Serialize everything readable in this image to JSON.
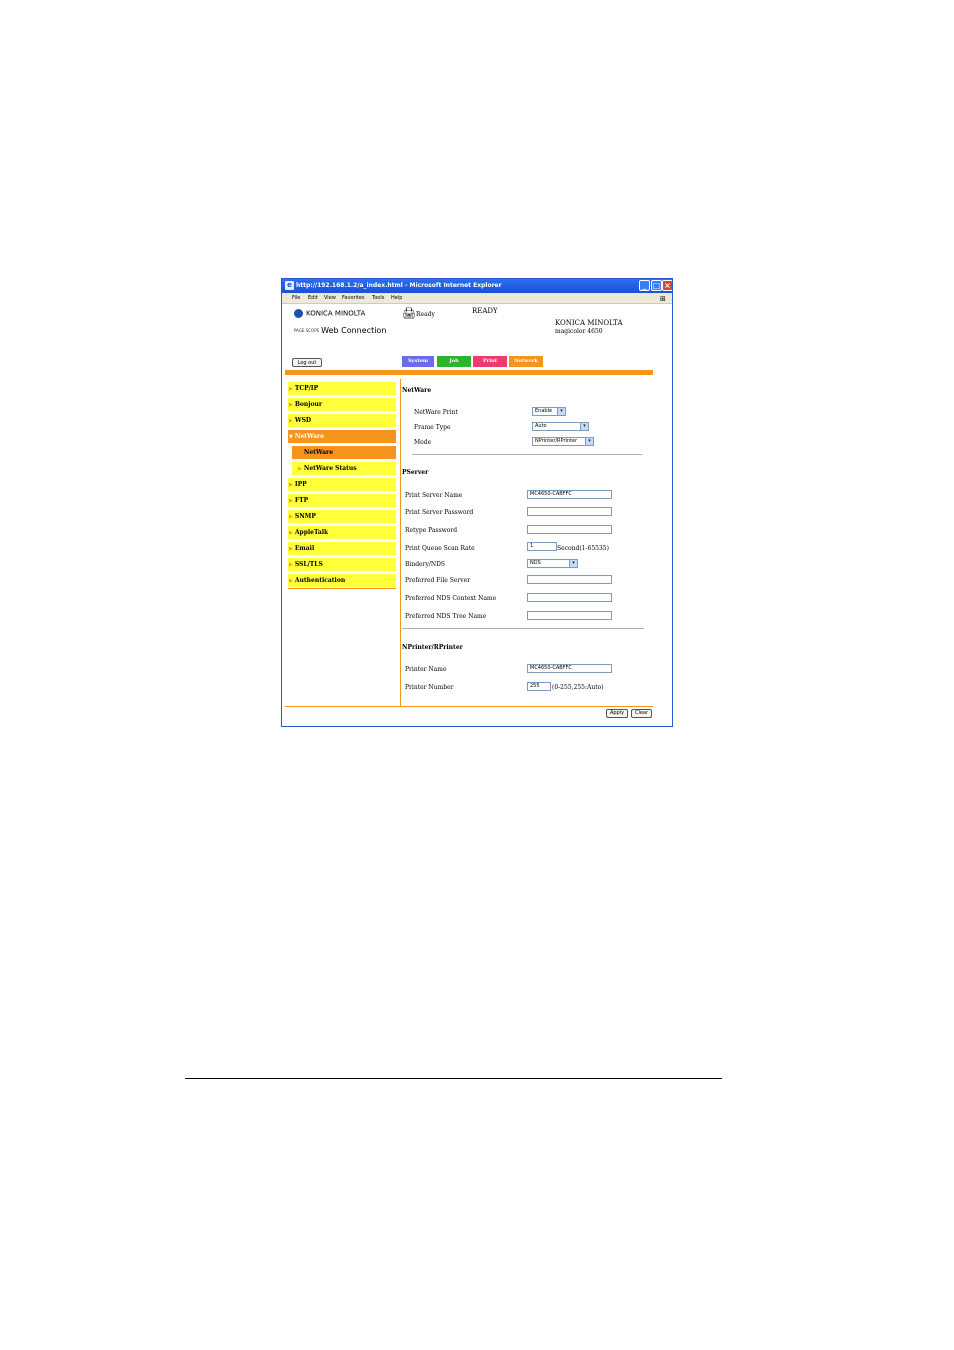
{
  "window": {
    "title": "http://192.168.1.2/a_index.html - Microsoft Internet Explorer",
    "menu": [
      "File",
      "Edit",
      "View",
      "Favorites",
      "Tools",
      "Help"
    ]
  },
  "header": {
    "brand": "KONICA MINOLTA",
    "pagescope_small": "PAGE SCOPE",
    "product": "Web Connection",
    "status_short": "Ready",
    "status_caps": "READY",
    "model_brand": "KONICA MINOLTA",
    "model_name": "magicolor 4650",
    "logout_label": "Log out"
  },
  "tabs": [
    {
      "label": "System",
      "color": "#6b6bef"
    },
    {
      "label": "Job",
      "color": "#2ab52a"
    },
    {
      "label": "Print",
      "color": "#ef3b6e"
    },
    {
      "label": "Network",
      "color": "#f7941d"
    }
  ],
  "sidebar": {
    "items": [
      {
        "label": "TCP/IP"
      },
      {
        "label": "Bonjour"
      },
      {
        "label": "WSD"
      },
      {
        "label": "NetWare"
      },
      {
        "label": "NetWare"
      },
      {
        "label": "NetWare Status"
      },
      {
        "label": "IPP"
      },
      {
        "label": "FTP"
      },
      {
        "label": "SNMP"
      },
      {
        "label": "AppleTalk"
      },
      {
        "label": "Email"
      },
      {
        "label": "SSL/TLS"
      },
      {
        "label": "Authentication"
      }
    ]
  },
  "netware": {
    "title": "NetWare",
    "print_label": "NetWare Print",
    "print_value": "Enable",
    "frame_label": "Frame Type",
    "frame_value": "Auto",
    "mode_label": "Mode",
    "mode_value": "NPrinter/RPrinter"
  },
  "pserver": {
    "title": "PServer",
    "name_label": "Print Server Name",
    "name_value": "MC4650-CABFFC",
    "password_label": "Print Server Password",
    "password_value": "",
    "retype_label": "Retype Password",
    "retype_value": "",
    "scan_label": "Print Queue Scan Rate",
    "scan_value": "1",
    "scan_unit": "Second(1-65535)",
    "bindery_label": "Bindery/NDS",
    "bindery_value": "NDS",
    "file_server_label": "Preferred File Server",
    "file_server_value": "",
    "context_label": "Preferred NDS Context Name",
    "context_value": "",
    "tree_label": "Preferred NDS Tree Name",
    "tree_value": ""
  },
  "nprinter": {
    "title": "NPrinter/RPrinter",
    "name_label": "Printer Name",
    "name_value": "MC4650-CABFFC",
    "number_label": "Printer Number",
    "number_value": "255",
    "number_hint": "(0-255,255:Auto)"
  },
  "buttons": {
    "apply": "Apply",
    "clear": "Clear"
  }
}
